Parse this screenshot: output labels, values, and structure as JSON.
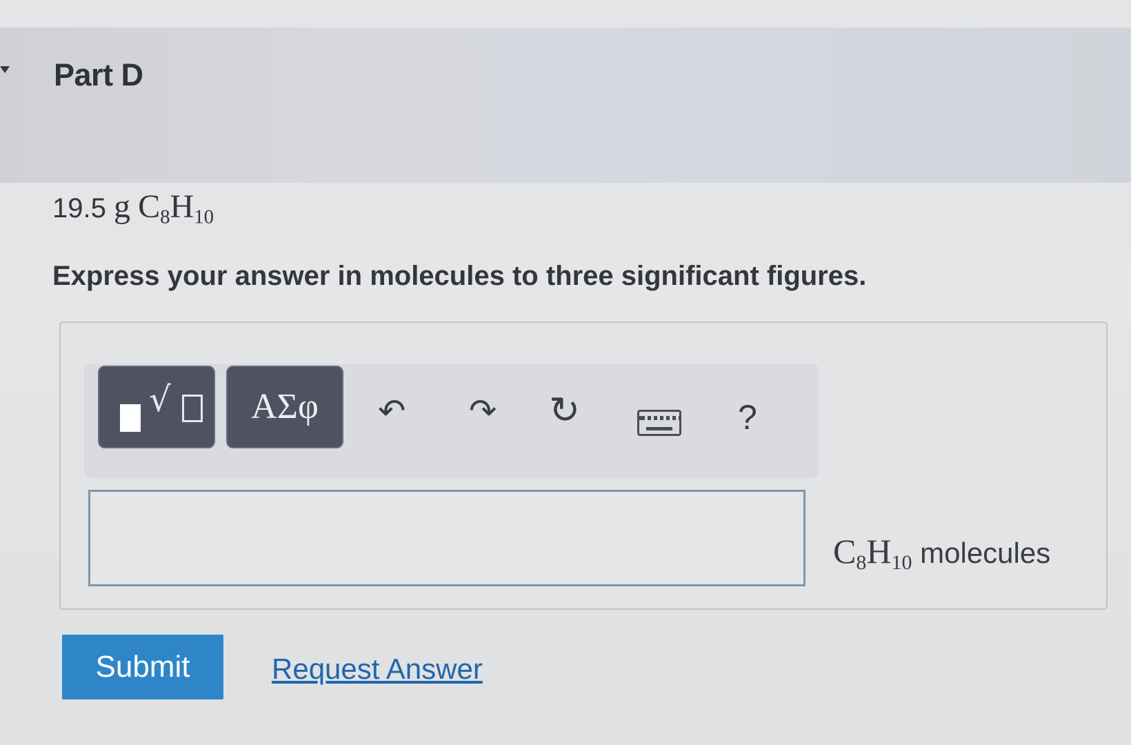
{
  "part": {
    "title": "Part D"
  },
  "problem": {
    "mass": "19.5",
    "unit": "g",
    "formula_c": "C",
    "formula_c_sub": "8",
    "formula_h": "H",
    "formula_h_sub": "10"
  },
  "instruction": "Express your answer in molecules to three significant figures.",
  "toolbar": {
    "templates_icon": "square-root-template-icon",
    "symbols_label": "ΑΣφ",
    "undo_icon": "undo-icon",
    "redo_icon": "redo-icon",
    "reset_icon": "reset-icon",
    "keyboard_icon": "keyboard-icon",
    "help_label": "?"
  },
  "answer": {
    "value": "",
    "unit_c": "C",
    "unit_c_sub": "8",
    "unit_h": "H",
    "unit_h_sub": "10",
    "unit_word": "molecules"
  },
  "actions": {
    "submit_label": "Submit",
    "request_answer_label": "Request Answer"
  },
  "colors": {
    "submit_bg": "#2e86c9",
    "link": "#1f66ad",
    "tool_dark": "#4f5361",
    "input_border": "#7d96ad"
  }
}
